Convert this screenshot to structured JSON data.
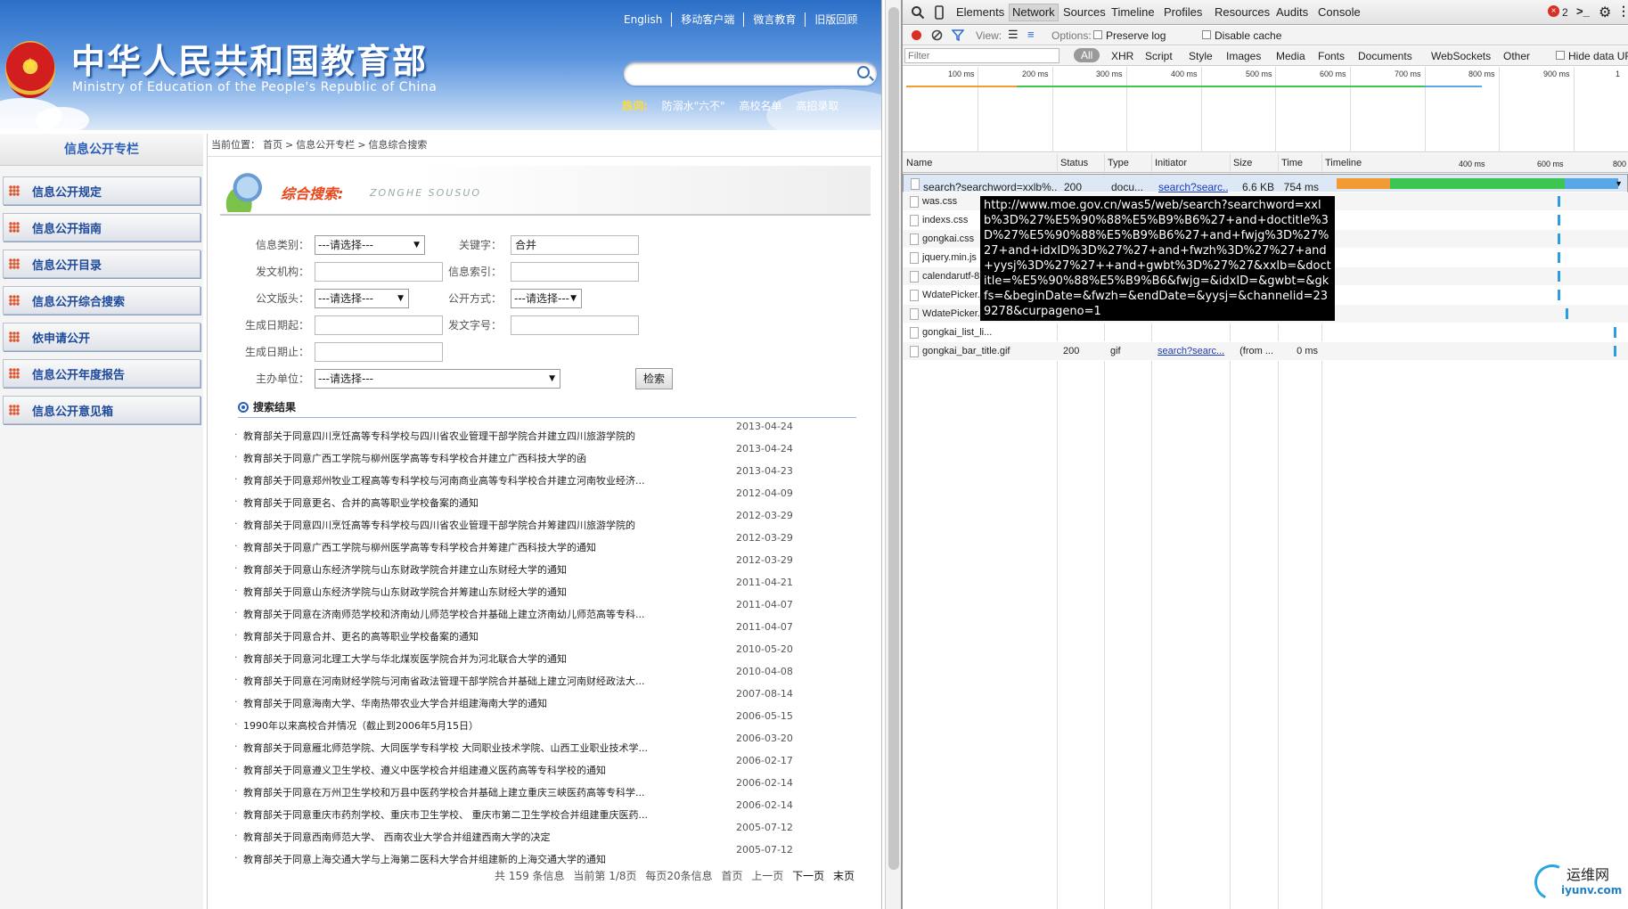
{
  "site": {
    "title": "中华人民共和国教育部",
    "subtitle": "Ministry of Education of the People's Republic of China",
    "top_links": [
      "English",
      "移动客户端",
      "微言教育",
      "旧版回顾"
    ],
    "hot_label": "热词:",
    "hot_words": [
      "防溺水\"六不\"",
      "高校名单",
      "高招录取"
    ]
  },
  "sidebar": {
    "title": "信息公开专栏",
    "items": [
      "信息公开规定",
      "信息公开指南",
      "信息公开目录",
      "信息公开综合搜索",
      "依申请公开",
      "信息公开年度报告",
      "信息公开意见箱"
    ]
  },
  "breadcrumb": {
    "prefix": "当前位置：",
    "items": [
      "首页",
      "信息公开专栏",
      "信息综合搜索"
    ],
    "sep": ">"
  },
  "section": {
    "title": "综合搜索:",
    "pinyin": "ZONGHE SOUSUO"
  },
  "form": {
    "category_label": "信息类别：",
    "category_value": "---请选择---",
    "keyword_label": "关键字：",
    "keyword_value": "合并",
    "issuer_label": "发文机构：",
    "issuer_value": "",
    "index_label": "信息索引：",
    "index_value": "",
    "header_label": "公文版头：",
    "header_value": "---请选择---",
    "method_label": "公开方式：",
    "method_value": "---请选择---",
    "date_from_label": "生成日期起：",
    "date_from_value": "",
    "docno_label": "发文字号：",
    "docno_value": "",
    "date_to_label": "生成日期止：",
    "date_to_value": "",
    "sponsor_label": "主办单位：",
    "sponsor_value": "---请选择---",
    "search_button": "检索"
  },
  "results": {
    "heading": "搜索结果",
    "items": [
      {
        "title": "教育部关于同意四川烹饪高等专科学校与四川省农业管理干部学院合并建立四川旅游学院的",
        "date": "2013-04-24"
      },
      {
        "title": "教育部关于同意广西工学院与柳州医学高等专科学校合并建立广西科技大学的函",
        "date": "2013-04-24"
      },
      {
        "title": "教育部关于同意郑州牧业工程高等专科学校与河南商业高等专科学校合并建立河南牧业经济...",
        "date": "2013-04-23"
      },
      {
        "title": "教育部关于同意更名、合并的高等职业学校备案的通知",
        "date": "2012-04-09"
      },
      {
        "title": "教育部关于同意四川烹饪高等专科学校与四川省农业管理干部学院合并筹建四川旅游学院的",
        "date": "2012-03-29"
      },
      {
        "title": "教育部关于同意广西工学院与柳州医学高等专科学校合并筹建广西科技大学的通知",
        "date": "2012-03-29"
      },
      {
        "title": "教育部关于同意山东经济学院与山东财政学院合并建立山东财经大学的通知",
        "date": "2012-03-29"
      },
      {
        "title": "教育部关于同意山东经济学院与山东财政学院合并筹建山东财经大学的通知",
        "date": "2011-04-21"
      },
      {
        "title": "教育部关于同意在济南师范学校和济南幼儿师范学校合并基础上建立济南幼儿师范高等专科...",
        "date": "2011-04-07"
      },
      {
        "title": "教育部关于同意合并、更名的高等职业学校备案的通知",
        "date": "2011-04-07"
      },
      {
        "title": "教育部关于同意河北理工大学与华北煤炭医学院合并为河北联合大学的通知",
        "date": "2010-05-20"
      },
      {
        "title": "教育部关于同意在河南财经学院与河南省政法管理干部学院合并基础上建立河南财经政法大...",
        "date": "2010-04-08"
      },
      {
        "title": "教育部关于同意海南大学、华南热带农业大学合并组建海南大学的通知",
        "date": "2007-08-14"
      },
      {
        "title": "1990年以来高校合并情况（截止到2006年5月15日）",
        "date": "2006-05-15"
      },
      {
        "title": "教育部关于同意雁北师范学院、大同医学专科学校 大同职业技术学院、山西工业职业技术学...",
        "date": "2006-03-20"
      },
      {
        "title": "教育部关于同意遵义卫生学校、遵义中医学校合并组建遵义医药高等专科学校的通知",
        "date": "2006-02-17"
      },
      {
        "title": "教育部关于同意在万州卫生学校和万县中医药学校合并基础上建立重庆三峡医药高等专科学...",
        "date": "2006-02-14"
      },
      {
        "title": "教育部关于同意重庆市药剂学校、重庆市卫生学校、 重庆市第二卫生学校合并组建重庆医药...",
        "date": "2006-02-14"
      },
      {
        "title": "教育部关于同意西南师范大学、 西南农业大学合并组建西南大学的决定",
        "date": "2005-07-12"
      },
      {
        "title": "教育部关于同意上海交通大学与上海第二医科大学合并组建新的上海交通大学的通知",
        "date": "2005-07-12"
      }
    ]
  },
  "pager": {
    "total": "共 159 条信息",
    "current": "当前第 1/8页",
    "per_page": "每页20条信息",
    "first": "首页",
    "prev": "上一页",
    "next": "下一页",
    "last": "末页"
  },
  "devtools": {
    "tabs": [
      "Elements",
      "Network",
      "Sources",
      "Timeline",
      "Profiles",
      "Resources",
      "Audits",
      "Console"
    ],
    "active_tab": "Network",
    "error_count": "2",
    "view_label": "View:",
    "options_label": "Options:",
    "preserve_log": "Preserve log",
    "disable_cache": "Disable cache",
    "filter_placeholder": "Filter",
    "filter_types": [
      "All",
      "XHR",
      "Script",
      "Style",
      "Images",
      "Media",
      "Fonts",
      "Documents",
      "WebSockets",
      "Other"
    ],
    "hide_data_urls": "Hide data UR",
    "ruler_ticks": [
      "100 ms",
      "200 ms",
      "300 ms",
      "400 ms",
      "500 ms",
      "600 ms",
      "700 ms",
      "800 ms",
      "900 ms",
      "1"
    ],
    "columns": [
      "Name",
      "Status",
      "Type",
      "Initiator",
      "Size",
      "Time",
      "Timeline"
    ],
    "timeline_ticks": [
      "400 ms",
      "600 ms",
      "800"
    ],
    "requests": [
      {
        "name": "search?searchword=xxlb%...",
        "status": "200",
        "type": "docu...",
        "initiator": "search?searc...",
        "size": "6.6 KB",
        "time": "754 ms"
      },
      {
        "name": "was.css",
        "status": "",
        "type": "",
        "initiator": "",
        "size": "",
        "time": ""
      },
      {
        "name": "indexs.css",
        "status": "",
        "type": "",
        "initiator": "",
        "size": "",
        "time": ""
      },
      {
        "name": "gongkai.css",
        "status": "",
        "type": "",
        "initiator": "",
        "size": "",
        "time": ""
      },
      {
        "name": "jquery.min.js",
        "status": "",
        "type": "",
        "initiator": "",
        "size": "",
        "time": ""
      },
      {
        "name": "calendarutf-8...",
        "status": "",
        "type": "",
        "initiator": "",
        "size": "",
        "time": ""
      },
      {
        "name": "WdatePicker.js",
        "status": "",
        "type": "",
        "initiator": "",
        "size": "",
        "time": ""
      },
      {
        "name": "WdatePicker.c...",
        "status": "",
        "type": "",
        "initiator": "",
        "size": "",
        "time": ""
      },
      {
        "name": "gongkai_list_li...",
        "status": "",
        "type": "",
        "initiator": "",
        "size": "",
        "time": ""
      },
      {
        "name": "gongkai_bar_title.gif",
        "status": "200",
        "type": "gif",
        "initiator": "search?searc...",
        "size": "(from ...",
        "time": "0 ms"
      }
    ],
    "tooltip": "http://www.moe.gov.cn/was5/web/search?searchword=xxlb%3D%27%E5%90%88%E5%B9%B6%27+and+doctitle%3D%27%E5%90%88%E5%B9%B6%27+and+fwjg%3D%27%27+and+idxID%3D%27%27+and+fwzh%3D%27%27+and+yysj%3D%27%27++and+gwbt%3D%27%27&xxlb=&doctitle=%E5%90%88%E5%B9%B6&fwjg=&idxID=&gwbt=&gkfs=&beginDate=&fwzh=&endDate=&yysj=&channelid=239278&curpageno=1"
  },
  "watermark": {
    "cn": "运维网",
    "url": "iyunv.com"
  },
  "colors": {
    "accent": "#2a60b8",
    "devtools_bg": "#f3f3f3",
    "tooltip_bg": "#000000"
  }
}
